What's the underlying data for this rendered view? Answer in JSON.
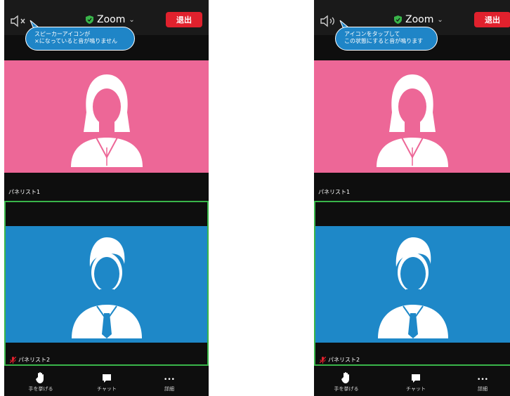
{
  "panels": [
    {
      "app_title": "Zoom",
      "leave_label": "退出",
      "speaker_state": "muted",
      "callout_line1": "スピーカーアイコンが",
      "callout_line2": "×になっていると音が鳴りません",
      "participant1": "パネリスト1",
      "participant2": "パネリスト2",
      "bottom": {
        "raise_hand": "手を挙げる",
        "chat": "チャット",
        "more_icon": "•••",
        "more": "詳細"
      }
    },
    {
      "app_title": "Zoom",
      "leave_label": "退出",
      "speaker_state": "on",
      "callout_line1": "アイコンをタップして",
      "callout_line2": "この状態にすると音が鳴ります",
      "participant1": "パネリスト1",
      "participant2": "パネリスト2",
      "bottom": {
        "raise_hand": "手を挙げる",
        "chat": "チャット",
        "more_icon": "•••",
        "more": "詳細"
      }
    }
  ],
  "colors": {
    "leave_red": "#e0212d",
    "pink_tile": "#ed6797",
    "blue_tile": "#1e88c8",
    "active_border": "#39b54a",
    "callout_blue": "#1f85c7",
    "shield_green": "#39b54a"
  }
}
